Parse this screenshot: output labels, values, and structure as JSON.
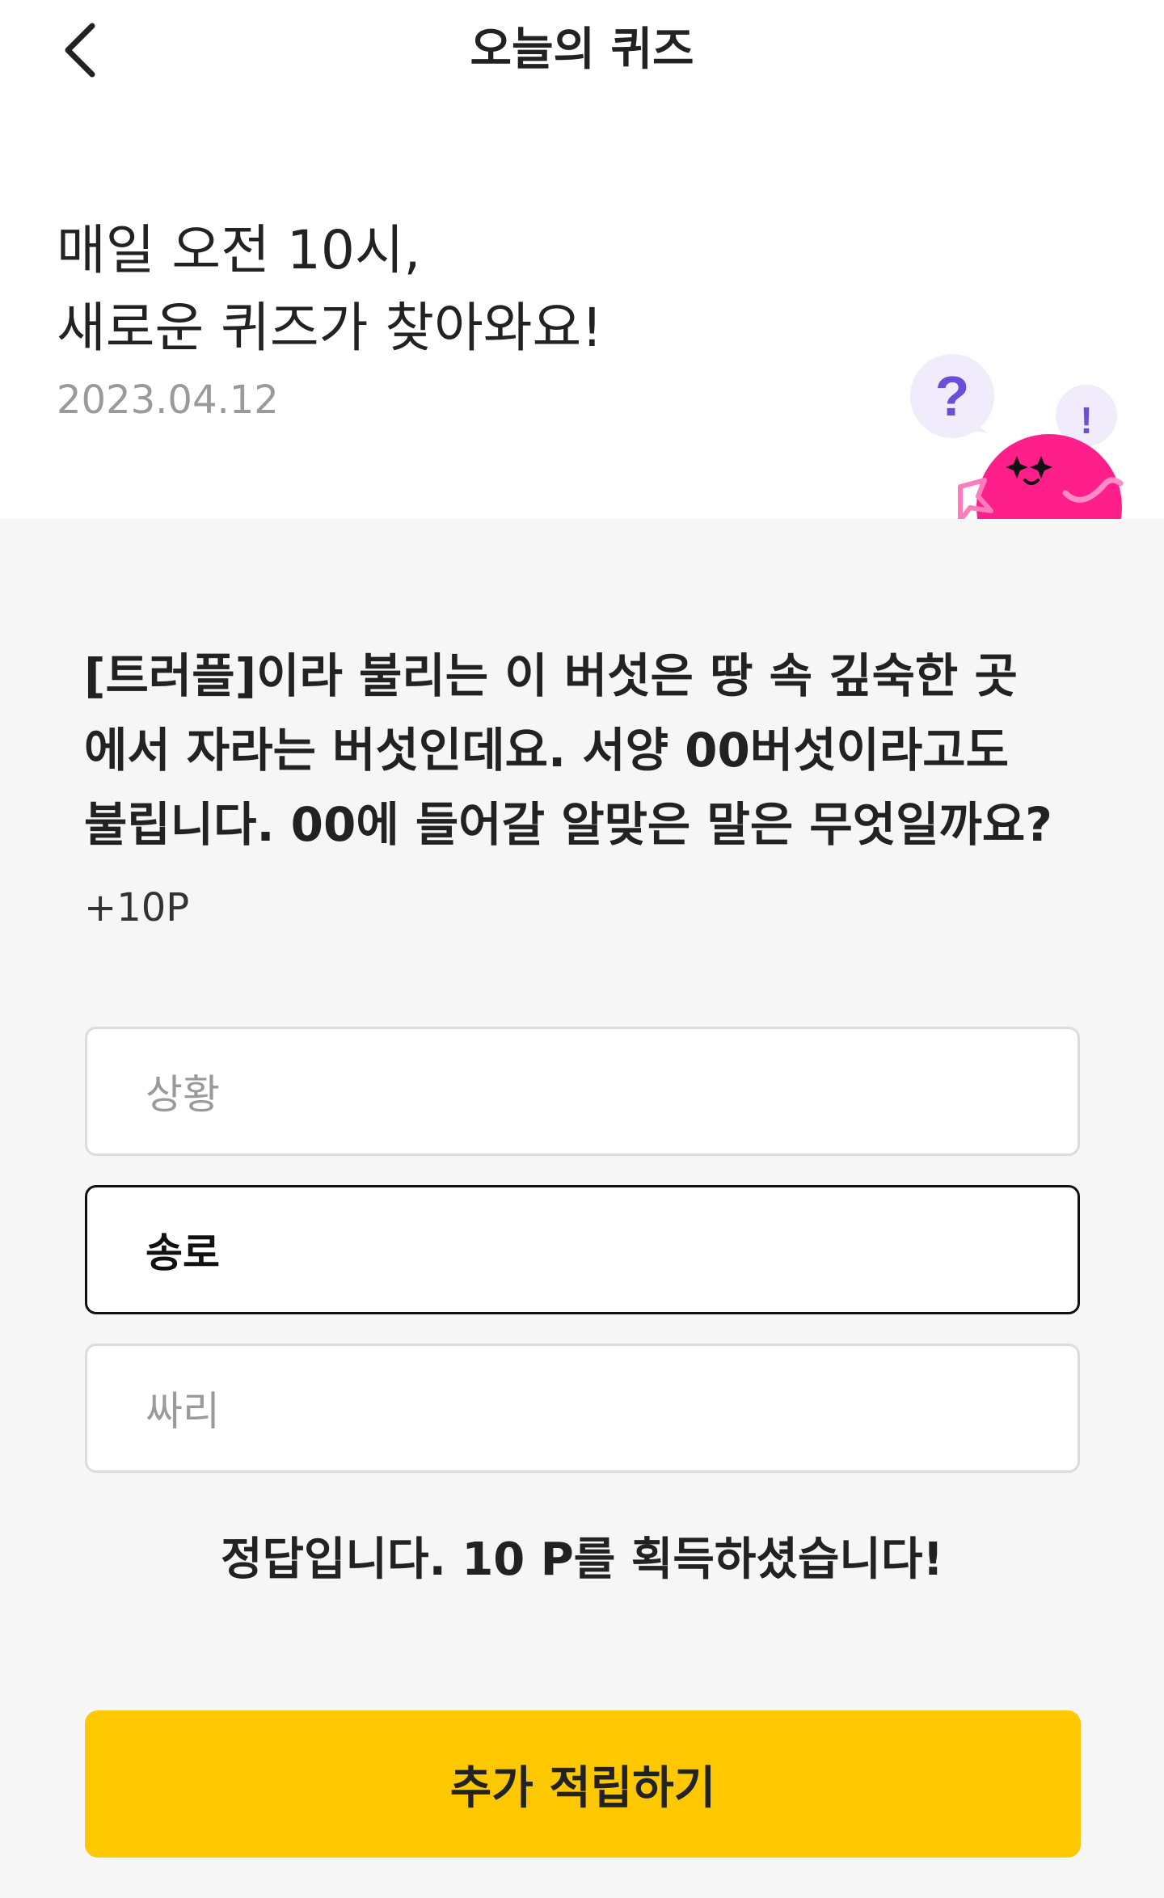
{
  "header": {
    "title": "오늘의 퀴즈"
  },
  "intro": {
    "line1": "매일 오전 10시,",
    "line2": "새로운 퀴즈가 찾아와요!",
    "date": "2023.04.12"
  },
  "mascot": {
    "bubble_question": "?",
    "bubble_exclaim": "!",
    "colors": {
      "body": "#ff1f8a",
      "bubble": "#f0ecfb",
      "glyph": "#6a4fd8"
    }
  },
  "quiz": {
    "question_lines": [
      "[트러플]이라 불리는 이 버섯은 땅 속 깊숙한 곳",
      "에서 자라는 버섯인데요. 서양 00버섯이라고도",
      "불립니다. 00에 들어갈 알맞은 말은 무엇일까요?"
    ],
    "points": "+10P",
    "options": [
      {
        "label": "상황",
        "selected": false
      },
      {
        "label": "송로",
        "selected": true
      },
      {
        "label": "싸리",
        "selected": false
      }
    ],
    "result": "정답입니다. 10 P를 획득하셨습니다!"
  },
  "cta": {
    "label": "추가 적립하기",
    "color": "#fdc800"
  }
}
